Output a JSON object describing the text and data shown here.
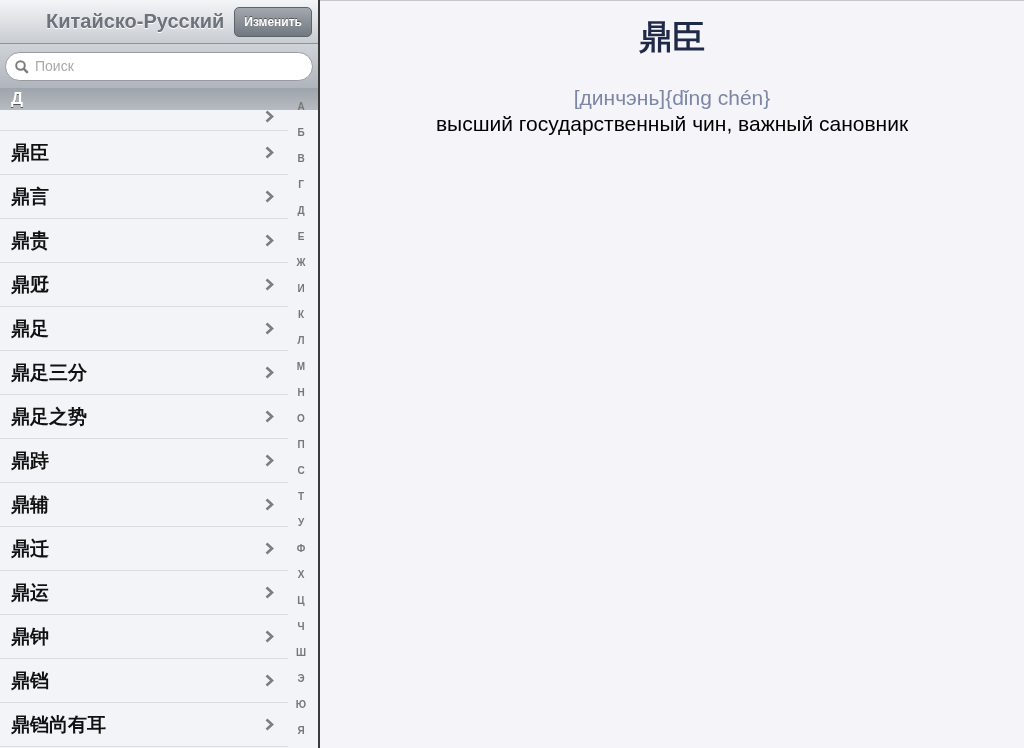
{
  "sidebar": {
    "title": "Китайско-Русский",
    "edit_button": "Изменить",
    "search": {
      "placeholder": "Поиск"
    },
    "section_header": "Д",
    "rows": [
      {
        "label": "鼎臣"
      },
      {
        "label": "鼎言"
      },
      {
        "label": "鼎贵"
      },
      {
        "label": "鼎觃"
      },
      {
        "label": "鼎足"
      },
      {
        "label": "鼎足三分"
      },
      {
        "label": "鼎足之势"
      },
      {
        "label": "鼎跱"
      },
      {
        "label": "鼎辅"
      },
      {
        "label": "鼎迁"
      },
      {
        "label": "鼎运"
      },
      {
        "label": "鼎钟"
      },
      {
        "label": "鼎铛"
      },
      {
        "label": "鼎铛尚有耳"
      }
    ],
    "index": [
      "А",
      "Б",
      "В",
      "Г",
      "Д",
      "Е",
      "Ж",
      "И",
      "К",
      "Л",
      "М",
      "Н",
      "О",
      "П",
      "С",
      "Т",
      "У",
      "Ф",
      "Х",
      "Ц",
      "Ч",
      "Ш",
      "Э",
      "Ю",
      "Я"
    ]
  },
  "entry": {
    "headword": "鼎臣",
    "transcription": "[динчэнь]{dǐng chén}",
    "definition": "высший государственный чин, важный сановник"
  }
}
